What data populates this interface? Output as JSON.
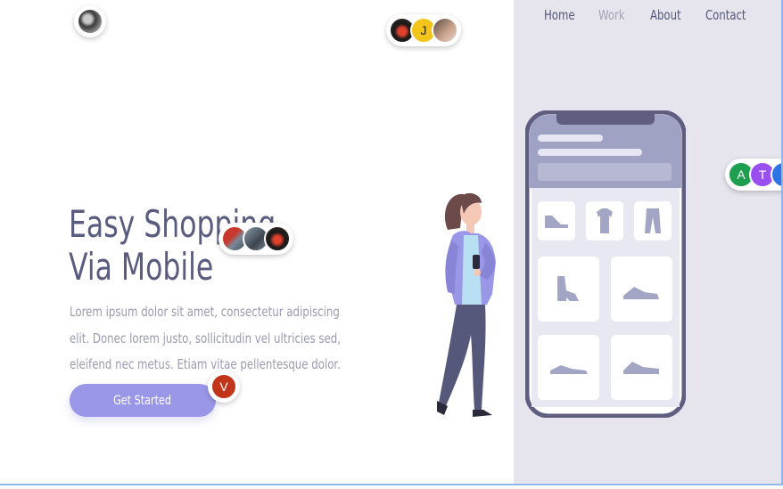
{
  "nav": {
    "items": [
      {
        "label": "Home"
      },
      {
        "label": "Work"
      },
      {
        "label": "About"
      },
      {
        "label": "Contact"
      }
    ]
  },
  "hero": {
    "headline_line1": "Easy Shopping",
    "headline_line2": "Via Mobile",
    "paragraph": "Lorem ipsum dolor sit amet, consectetur  adipiscing elit. Donec lorem justo, sollicitudin vel ultricies sed, eleifend nec metus. Etiam vitae pellentesque dolor.",
    "cta_label": "Get Started"
  },
  "presence": {
    "group_top_left": [
      {
        "type": "photo"
      }
    ],
    "group_top_center": [
      {
        "type": "photo"
      },
      {
        "initial": "J",
        "color": "#f3c419"
      },
      {
        "type": "photo"
      }
    ],
    "group_headline": [
      {
        "type": "photo"
      },
      {
        "type": "photo"
      },
      {
        "type": "photo"
      }
    ],
    "group_button": [
      {
        "initial": "V",
        "color": "#c1361a"
      }
    ],
    "group_right": [
      {
        "initial": "A",
        "color": "#1e9e4f"
      },
      {
        "initial": "T",
        "color": "#9a4ff0"
      },
      {
        "initial": "",
        "color": "#2a74e6"
      }
    ]
  },
  "colors": {
    "accent": "#9a97e8",
    "text_dark": "#595c7e",
    "text_muted": "#9b9ab0",
    "panel_bg": "#e6e4ed"
  },
  "illustration": {
    "subject": "woman-holding-phone",
    "phone_products": [
      "flat-shoe-icon",
      "tshirt-icon",
      "pants-icon",
      "boot-icon",
      "sneaker-icon",
      "sneaker-icon",
      "sneaker-icon"
    ]
  }
}
